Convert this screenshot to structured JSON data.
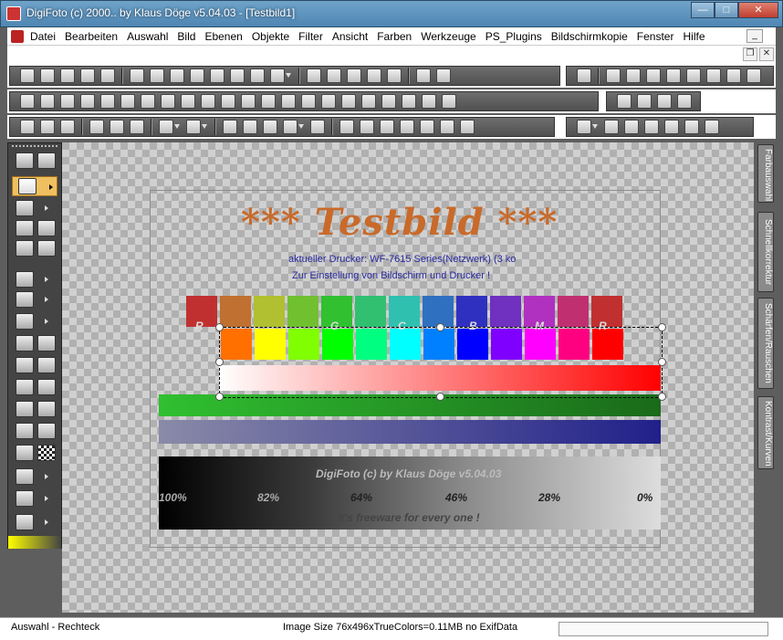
{
  "window": {
    "title": "DigiFoto (c) 2000.. by Klaus Döge v5.04.03 - [Testbild1]"
  },
  "menu": [
    "Datei",
    "Bearbeiten",
    "Auswahl",
    "Bild",
    "Ebenen",
    "Objekte",
    "Filter",
    "Ansicht",
    "Farben",
    "Werkzeuge",
    "PS_Plugins",
    "Bildschirmkopie",
    "Fenster",
    "Hilfe"
  ],
  "image": {
    "title": "*** Testbild ***",
    "line1": "aktueller Drucker: WF-7615 Series(Netzwerk) (3 ko",
    "line2": "Zur Einstellung von Bildschirm und Drucker !",
    "swatch_letters": [
      "R",
      "G",
      "C",
      "B",
      "M",
      "R"
    ],
    "swatch_colors": [
      "#c03030",
      "#c07030",
      "#b0c030",
      "#70c030",
      "#30c030",
      "#30c070",
      "#30c0b0",
      "#3070c0",
      "#3030c0",
      "#7030c0",
      "#b030c0",
      "#c03070",
      "#c03030"
    ],
    "bright_colors": [
      "#ff7000",
      "#ffff00",
      "#80ff00",
      "#00ff00",
      "#00ff80",
      "#00ffff",
      "#0080ff",
      "#0000ff",
      "#8000ff",
      "#ff00ff",
      "#ff0080",
      "#ff0000"
    ],
    "gray_title": "DigiFoto (c) by Klaus Döge v5.04.03",
    "percents": [
      "100%",
      "82%",
      "64%",
      "46%",
      "28%",
      "0%"
    ],
    "gray_footer": "It's freeware for every one !"
  },
  "sidetabs": [
    "Farbauswahl",
    "Schnellkorrektur",
    "Schärfen/Rauschen",
    "Kontrast/Kurven"
  ],
  "status": {
    "left": "Auswahl - Rechteck",
    "info": "Image Size 76x496xTrueColors=0.11MB  no ExifData"
  }
}
